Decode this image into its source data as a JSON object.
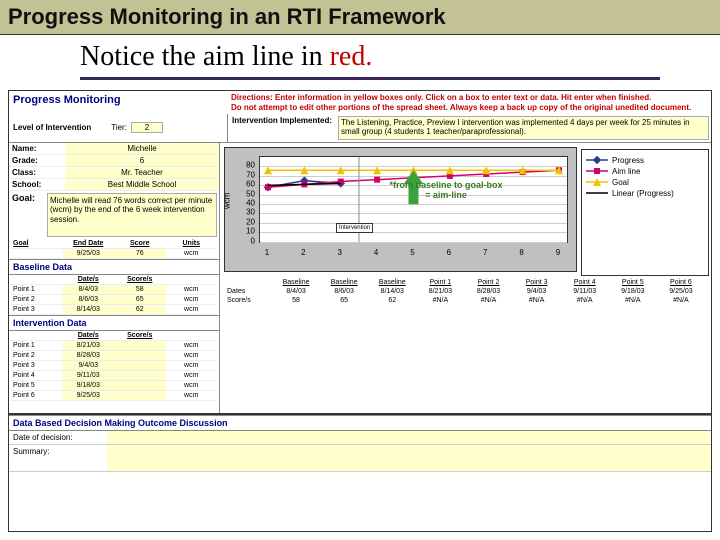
{
  "slide_title": "Progress Monitoring in an RTI Framework",
  "subtitle_pre": "Notice the aim line in ",
  "subtitle_red": "red.",
  "sheet": {
    "heading": "Progress Monitoring",
    "directions_l1": "Directions:  Enter information in yellow boxes only.  Click on a box to enter text or data.  Hit enter when finished.",
    "directions_l2": "Do not attempt to edit other portions of the spread sheet.  Always keep a back up copy of the original unedited document.",
    "level_label": "Level of Intervention",
    "tier_label": "Tier:",
    "tier_value": "2",
    "intervention_label": "Intervention Implemented:",
    "intervention_text": "The Listening, Practice, Preview I intervention was implemented 4 days per week for 25 minutes in small group (4 students 1 teacher/paraprofessional).",
    "student": {
      "name_label": "Name:",
      "name": "Michelle",
      "grade_label": "Grade:",
      "grade": "6",
      "class_label": "Class:",
      "class": "Mr. Teacher",
      "school_label": "School:",
      "school": "Best Middle School"
    },
    "goal_label": "Goal:",
    "goal_text": "Michelle will read 76 words correct per minute (wcm) by the end of the 6 week intervention session.",
    "goal_row": {
      "h1": "Goal",
      "h2": "End Date",
      "h3": "Score",
      "h4": "Units",
      "date": "9/25/03",
      "score": "76",
      "units": "wcm"
    },
    "baseline": {
      "title": "Baseline Data",
      "h1": "Date/s",
      "h2": "Score/s",
      "rows": [
        {
          "p": "Point 1",
          "d": "8/4/03",
          "s": "58",
          "u": "wcm"
        },
        {
          "p": "Point 2",
          "d": "8/6/03",
          "s": "65",
          "u": "wcm"
        },
        {
          "p": "Point 3",
          "d": "8/14/03",
          "s": "62",
          "u": "wcm"
        }
      ]
    },
    "intervention": {
      "title": "Intervention Data",
      "h1": "Date/s",
      "h2": "Score/s",
      "rows": [
        {
          "p": "Point 1",
          "d": "8/21/03",
          "s": "",
          "u": "wcm"
        },
        {
          "p": "Point 2",
          "d": "8/28/03",
          "s": "",
          "u": "wcm"
        },
        {
          "p": "Point 3",
          "d": "9/4/03",
          "s": "",
          "u": "wcm"
        },
        {
          "p": "Point 4",
          "d": "9/11/03",
          "s": "",
          "u": "wcm"
        },
        {
          "p": "Point 5",
          "d": "9/18/03",
          "s": "",
          "u": "wcm"
        },
        {
          "p": "Point 6",
          "d": "9/25/03",
          "s": "",
          "u": "wcm"
        }
      ]
    },
    "bottom": {
      "row1_label": "Dates",
      "row2_label": "Score/s",
      "cols": [
        "Baseline",
        "Baseline",
        "Baseline",
        "Point 1",
        "Point 2",
        "Point 3",
        "Point 4",
        "Point 5",
        "Point 6"
      ],
      "dates": [
        "8/4/03",
        "8/6/03",
        "8/14/03",
        "8/21/03",
        "8/28/03",
        "9/4/03",
        "9/11/03",
        "9/18/03",
        "9/25/03"
      ],
      "scores": [
        "58",
        "65",
        "62",
        "#N/A",
        "#N/A",
        "#N/A",
        "#N/A",
        "#N/A",
        "#N/A"
      ]
    },
    "discussion": {
      "title": "Data Based Decision Making Outcome Discussion",
      "date_label": "Date of decision:",
      "summary_label": "Summary:"
    }
  },
  "chart_data": {
    "type": "line",
    "x": [
      1,
      2,
      3,
      4,
      5,
      6,
      7,
      8,
      9
    ],
    "ylabel": "wcm",
    "ylim": [
      0,
      90
    ],
    "yticks": [
      0,
      10,
      20,
      30,
      40,
      50,
      60,
      70,
      80
    ],
    "series": [
      {
        "name": "Progress",
        "color": "#2a3b8f",
        "marker": "diamond",
        "values": [
          58,
          65,
          62,
          null,
          null,
          null,
          null,
          null,
          null
        ]
      },
      {
        "name": "Aim line",
        "color": "#d2006b",
        "marker": "square",
        "values": [
          58,
          61,
          64,
          66,
          68,
          70,
          72,
          74,
          76
        ]
      },
      {
        "name": "Goal",
        "color": "#f2c200",
        "marker": "triangle",
        "values": [
          76,
          76,
          76,
          76,
          76,
          76,
          76,
          76,
          76
        ]
      },
      {
        "name": "Linear (Progress)",
        "color": "#000",
        "marker": "none",
        "values": [
          60,
          61,
          62,
          null,
          null,
          null,
          null,
          null,
          null
        ],
        "dash": true
      }
    ],
    "legend": [
      "Progress",
      "Aim line",
      "Goal",
      "Linear (Progress)"
    ],
    "callout": "*from baseline to goal-box = aim-line",
    "intervention_marker_after_x": 3,
    "intervention_marker_label": "Intervention"
  }
}
